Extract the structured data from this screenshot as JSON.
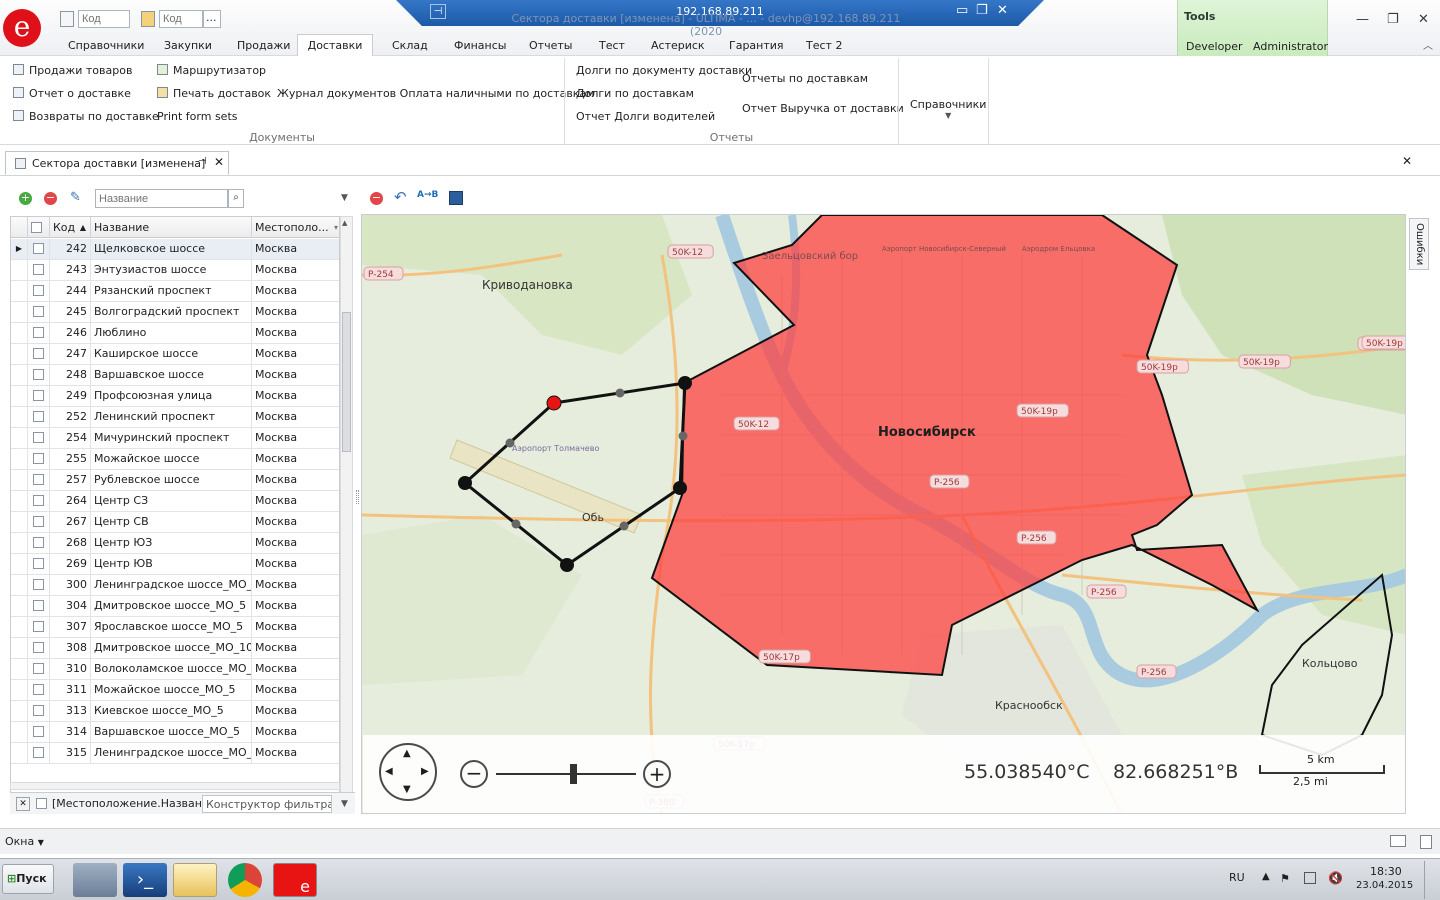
{
  "window": {
    "ip": "192.168.89.211",
    "title_ghost": "Сектора доставки [изменена] - ULTIMA - ... - devhp@192.168.89.211 (2020",
    "logo_letter": "e"
  },
  "quick_access": {
    "code_placeholder_1": "Код",
    "code_placeholder_2": "Код",
    "ellipsis": "..."
  },
  "menu_tabs": [
    "Справочники",
    "Закупки",
    "Продажи",
    "Доставки",
    "Склад",
    "Финансы",
    "Отчеты",
    "Тест",
    "Астериск",
    "Гарантия",
    "Тест 2"
  ],
  "active_menu_tab": "Доставки",
  "tools": {
    "title": "Tools",
    "tabs": [
      "Developer",
      "Administrator"
    ]
  },
  "ribbon": {
    "documents": {
      "label": "Документы",
      "items": [
        "Продажи товаров",
        "Отчет о доставке",
        "Возвраты по доставке",
        "Маршрутизатор",
        "Печать доставок",
        "Print form sets",
        "Журнал документов Оплата наличными по доставкам"
      ]
    },
    "reports": {
      "label": "Отчеты",
      "items": [
        "Долги по документу доставки",
        "Долги по доставкам",
        "Отчет Долги водителей",
        "Отчеты по доставкам",
        "Отчет Выручка от доставки"
      ]
    },
    "references": {
      "label": "Справочники"
    }
  },
  "doc_tab": {
    "title": "Сектора доставки [изменена]",
    "pin": "⊣",
    "close": "✕"
  },
  "left_toolbar": {
    "search_placeholder": "Название"
  },
  "grid": {
    "columns": [
      "Код",
      "Название",
      "Местополо..."
    ],
    "rows": [
      {
        "code": "242",
        "name": "Щелковское шоссе",
        "loc": "Москва"
      },
      {
        "code": "243",
        "name": "Энтузиастов шоссе",
        "loc": "Москва"
      },
      {
        "code": "244",
        "name": "Рязанский проспект",
        "loc": "Москва"
      },
      {
        "code": "245",
        "name": "Волгоградский проспект",
        "loc": "Москва"
      },
      {
        "code": "246",
        "name": "Люблино",
        "loc": "Москва"
      },
      {
        "code": "247",
        "name": "Каширское шоссе",
        "loc": "Москва"
      },
      {
        "code": "248",
        "name": "Варшавское шоссе",
        "loc": "Москва"
      },
      {
        "code": "249",
        "name": "Профсоюзная улица",
        "loc": "Москва"
      },
      {
        "code": "252",
        "name": "Ленинский проспект",
        "loc": "Москва"
      },
      {
        "code": "254",
        "name": "Мичуринский проспект",
        "loc": "Москва"
      },
      {
        "code": "255",
        "name": "Можайское шоссе",
        "loc": "Москва"
      },
      {
        "code": "257",
        "name": "Рублевское шоссе",
        "loc": "Москва"
      },
      {
        "code": "264",
        "name": "Центр СЗ",
        "loc": "Москва"
      },
      {
        "code": "267",
        "name": "Центр СВ",
        "loc": "Москва"
      },
      {
        "code": "268",
        "name": "Центр ЮЗ",
        "loc": "Москва"
      },
      {
        "code": "269",
        "name": "Центр ЮВ",
        "loc": "Москва"
      },
      {
        "code": "300",
        "name": "Ленинградское шоссе_МО_5",
        "loc": "Москва"
      },
      {
        "code": "304",
        "name": "Дмитровское шоссе_МО_5",
        "loc": "Москва"
      },
      {
        "code": "307",
        "name": "Ярославское шоссе_МО_5",
        "loc": "Москва"
      },
      {
        "code": "308",
        "name": "Дмитровское шоссе_МО_10",
        "loc": "Москва"
      },
      {
        "code": "310",
        "name": "Волоколамское шоссе_МО_5",
        "loc": "Москва"
      },
      {
        "code": "311",
        "name": "Можайское шоссе_МО_5",
        "loc": "Москва"
      },
      {
        "code": "313",
        "name": "Киевское шоссе_МО_5",
        "loc": "Москва"
      },
      {
        "code": "314",
        "name": "Варшавское шоссе_МО_5",
        "loc": "Москва"
      },
      {
        "code": "315",
        "name": "Ленинградское шоссе_МО_10",
        "loc": "Москва"
      }
    ]
  },
  "filter": {
    "text": "[Местоположение.Названи...",
    "builder": "Конструктор фильтра..."
  },
  "map": {
    "labels": [
      "Криводановка",
      "Новосибирск",
      "Обь",
      "Краснообск",
      "Кольцово",
      "Аэропорт Толмачево",
      "Заельцовский бор",
      "Аэропорт Новосибирск-Северный",
      "Аэродром Ельцовка"
    ],
    "road_labels": [
      "P-254",
      "50K-12",
      "50K-12",
      "50K-19р",
      "50K-19р",
      "50K-19р",
      "50K-19р",
      "50K-19р",
      "P-256",
      "P-256",
      "P-256",
      "P-256",
      "50K-17р",
      "50K-17р",
      "P-380"
    ],
    "latitude": "55.038540°C",
    "longitude": "82.668251°B",
    "scale_km": "5 km",
    "scale_mi": "2,5 mi",
    "zoom_level": 0.55,
    "sector_color": "#ff3c3c"
  },
  "errors_tab": "Ошибки",
  "windows_menu": "Окна",
  "taskbar": {
    "start": "Пуск",
    "lang": "RU",
    "time": "18:30",
    "date": "23.04.2015"
  }
}
